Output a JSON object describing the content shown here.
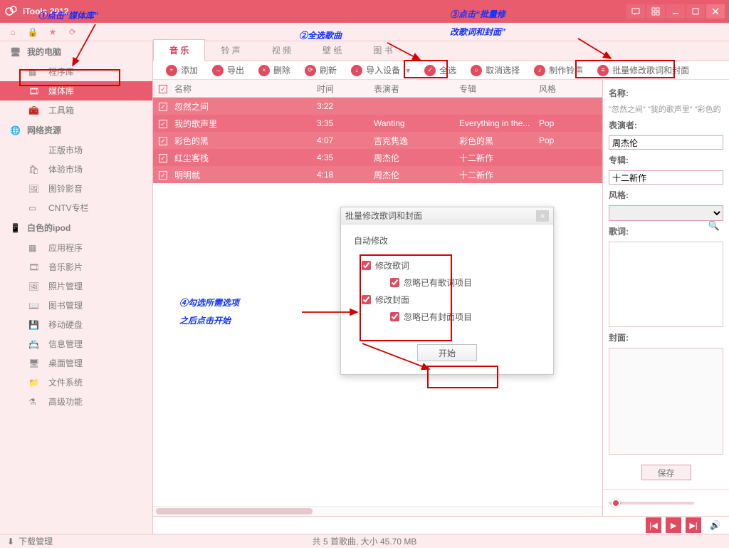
{
  "app": {
    "title": "iTools 2012"
  },
  "annotations": {
    "a1": "①点击“媒体库”",
    "a2": "②全选歌曲",
    "a3_l1": "③点击“批量修",
    "a3_l2": "改歌词和封面”",
    "a4_l1": "④勾选所需选项",
    "a4_l2": "之后点击开始"
  },
  "sidebar": {
    "g_computer": "我的电脑",
    "items_computer": [
      "程序库",
      "媒体库",
      "工具箱"
    ],
    "g_network": "网络资源",
    "items_network": [
      "正版市场",
      "体验市场",
      "图铃影音",
      "CNTV专栏"
    ],
    "g_device": "白色的ipod",
    "items_device": [
      "应用程序",
      "音乐影片",
      "照片管理",
      "图书管理",
      "移动硬盘",
      "信息管理",
      "桌面管理",
      "文件系统",
      "高级功能"
    ],
    "download": "下载管理"
  },
  "tabs": [
    "音 乐",
    "铃 声",
    "视 频",
    "壁 纸",
    "图 书"
  ],
  "toolbar": {
    "add": "添加",
    "export": "导出",
    "delete": "删除",
    "refresh": "刷新",
    "import": "导入设备",
    "selectall": "全选",
    "deselect": "取消选择",
    "ringtone": "制作铃声",
    "batch": "批量修改歌词和封面"
  },
  "columns": {
    "name": "名称",
    "time": "时间",
    "artist": "表演者",
    "album": "专辑",
    "genre": "风格"
  },
  "rows": [
    {
      "name": "忽然之间",
      "time": "3:22",
      "artist": "",
      "album": "",
      "genre": ""
    },
    {
      "name": "我的歌声里",
      "time": "3:35",
      "artist": "Wanting",
      "album": "Everything in the...",
      "genre": "Pop"
    },
    {
      "name": "彩色的黑",
      "time": "4:07",
      "artist": "吉克隽逸",
      "album": "彩色的黑",
      "genre": "Pop"
    },
    {
      "name": "红尘客栈",
      "time": "4:35",
      "artist": "周杰伦",
      "album": "十二新作",
      "genre": ""
    },
    {
      "name": "明明就",
      "time": "4:18",
      "artist": "周杰伦",
      "album": "十二新作",
      "genre": ""
    }
  ],
  "dialog": {
    "title": "批量修改歌词和封面",
    "group": "自动修改",
    "opt_lyrics": "修改歌词",
    "opt_lyrics_skip": "忽略已有歌词项目",
    "opt_cover": "修改封面",
    "opt_cover_skip": "忽略已有封面项目",
    "start": "开始"
  },
  "side": {
    "name_label": "名称:",
    "name_value": "\"忽然之间\" \"我的歌声里\" \"彩色的",
    "artist_label": "表演者:",
    "artist_value": "周杰伦",
    "album_label": "专辑:",
    "album_value": "十二新作",
    "genre_label": "风格:",
    "lyrics_label": "歌词:",
    "cover_label": "封面:",
    "save": "保存"
  },
  "status": "共 5 首歌曲, 大小 45.70 MB"
}
